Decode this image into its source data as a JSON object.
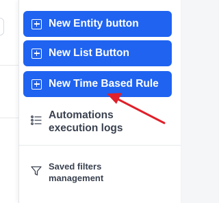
{
  "menu": {
    "buttons": [
      {
        "label": "New Entity button",
        "icon": "plus-square-icon"
      },
      {
        "label": "New List Button",
        "icon": "plus-square-icon"
      },
      {
        "label": "New Time Based Rule",
        "icon": "plus-square-icon"
      }
    ],
    "items": [
      {
        "label_line1": "Automations",
        "label_line2": "execution logs",
        "icon": "list-icon"
      },
      {
        "label_line1": "Saved filters",
        "label_line2": "management",
        "icon": "filter-icon"
      }
    ]
  },
  "colors": {
    "button_bg": "#1f63f0",
    "button_text": "#ffffff",
    "item_text": "#3a4250",
    "arrow": "#e0202a"
  }
}
